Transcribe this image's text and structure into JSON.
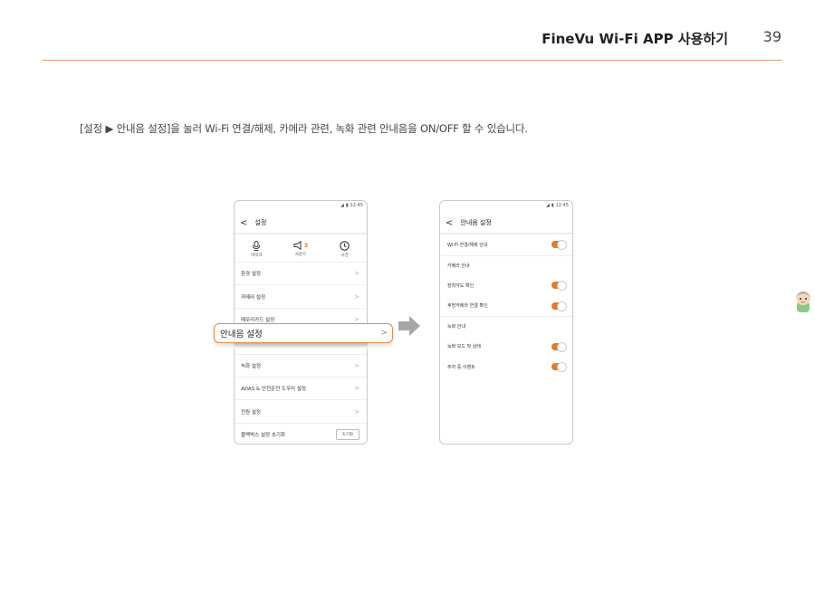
{
  "header": {
    "title": "FineVu Wi-Fi APP 사용하기",
    "page_number": "39"
  },
  "intro_text": "[설정 ▶ 안내음 설정]을 눌러 Wi-Fi 연결/해제, 카메라 관련, 녹화 관련 안내음을 ON/OFF 할 수 있습니다.",
  "left_screen": {
    "status_time": "12:45",
    "title": "설정",
    "quick": [
      {
        "icon": "microphone-icon",
        "label": "마이크"
      },
      {
        "icon": "speaker-icon",
        "label": "사운드",
        "badge": "3"
      },
      {
        "icon": "clock-icon",
        "label": "시간"
      }
    ],
    "menu": [
      "환경 설정",
      "카메라 설정",
      "메모리카드 설정",
      "녹화 설정",
      "ADAS & 안전운전 도우미 설정",
      "전원 설정"
    ],
    "reset_label": "블랙박스 설정 초기화",
    "reset_button": "초기화"
  },
  "highlight_label": "안내음 설정",
  "right_screen": {
    "status_time": "12:45",
    "title": "안내음 설정",
    "wifi_item": "Wi-Fi 연결/해제 안내",
    "camera_section": "카메라 안내",
    "camera_items": [
      "장착각도 확인",
      "후방카메라 연결 확인"
    ],
    "record_section": "녹화 안내",
    "record_items": [
      "녹화 모드 및 상태",
      "주차 중 이벤트"
    ]
  },
  "colors": {
    "accent": "#e07b27",
    "rule": "#e8956a"
  }
}
